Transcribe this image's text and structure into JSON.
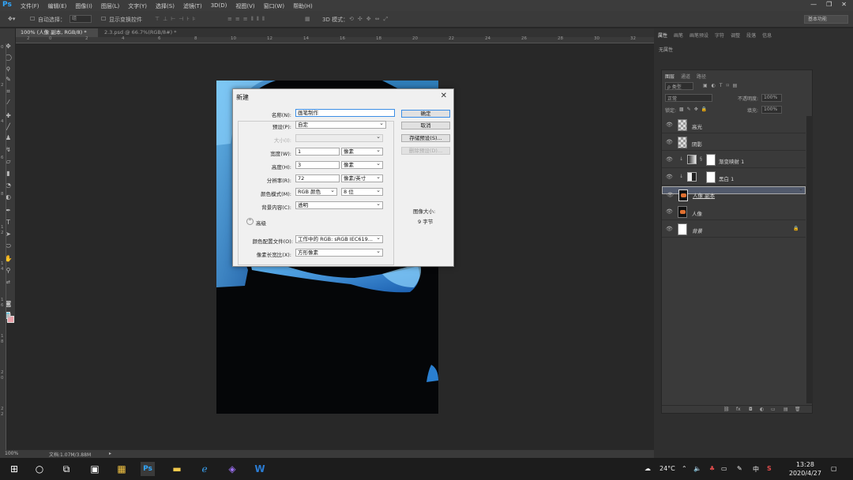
{
  "app": {
    "logo": "Ps",
    "menu": [
      "文件(F)",
      "编辑(E)",
      "图像(I)",
      "图层(L)",
      "文字(Y)",
      "选择(S)",
      "滤镜(T)",
      "3D(D)",
      "视图(V)",
      "窗口(W)",
      "帮助(H)"
    ],
    "window_controls": [
      "—",
      "❐",
      "✕"
    ]
  },
  "options_bar": {
    "auto_select": "自动选择：",
    "auto_select_value": "组",
    "show_transform": "显示变换控件",
    "mode_3d": "3D 模式：",
    "workspace": "基本功能"
  },
  "tabs": [
    {
      "label": "100% (人像 副本, RGB/8) *",
      "active": true
    },
    {
      "label": "2.3.psd @ 66.7%(RGB/8#) *",
      "active": false
    }
  ],
  "ruler_h": [
    "2",
    "0",
    "2",
    "4",
    "6",
    "8",
    "10",
    "12",
    "14",
    "16",
    "18",
    "20",
    "22",
    "24",
    "26",
    "28",
    "30",
    "32"
  ],
  "ruler_v": [
    "0",
    "2",
    "4",
    "6",
    "8",
    "1",
    "2",
    "1",
    "4",
    "1",
    "6",
    "1",
    "8",
    "2",
    "0",
    "2",
    "2"
  ],
  "statusbar": {
    "zoom": "100%",
    "doc": "文档:1.07M/3.88M"
  },
  "right_panel": {
    "tabs": [
      "属性",
      "画笔",
      "画笔预设",
      "字符",
      "调整",
      "段落",
      "信息"
    ],
    "sub": "无属性"
  },
  "layers_panel": {
    "tabs": [
      "图层",
      "通道",
      "路径"
    ],
    "kind": "ρ 类型",
    "blend": "正常",
    "opacity_label": "不透明度:",
    "opacity": "100%",
    "lock_label": "锁定:",
    "fill_label": "填充:",
    "fill": "100%",
    "layers": [
      {
        "name": "高光",
        "type": "transparent"
      },
      {
        "name": "阴影",
        "type": "transparent"
      },
      {
        "name": "渐变映射 1",
        "type": "adjust"
      },
      {
        "name": "黑白 1",
        "type": "adjust"
      },
      {
        "name": "人像 副本",
        "type": "photo",
        "selected": true
      },
      {
        "name": "人像",
        "type": "photo"
      },
      {
        "name": "背景",
        "type": "white",
        "locked": true
      }
    ],
    "bottom_icons": [
      "⛓",
      "fx",
      "◘",
      "◐",
      "▭",
      "▤",
      "🗑"
    ]
  },
  "dialog": {
    "title": "新建",
    "close": "✕",
    "name_label": "名称(N):",
    "name_value": "画笔制作",
    "preset_label": "预设(P):",
    "preset_value": "自定",
    "size_label": "大小(I):",
    "width_label": "宽度(W):",
    "width_value": "1",
    "width_unit": "像素",
    "height_label": "高度(H):",
    "height_value": "3",
    "height_unit": "像素",
    "res_label": "分辨率(R):",
    "res_value": "72",
    "res_unit": "像素/英寸",
    "mode_label": "颜色模式(M):",
    "mode_value": "RGB 颜色",
    "bits_value": "8 位",
    "bg_label": "背景内容(C):",
    "bg_value": "透明",
    "advanced": "高级",
    "profile_label": "颜色配置文件(O):",
    "profile_value": "工作中的 RGB: sRGB IEC619...",
    "aspect_label": "像素长宽比(X):",
    "aspect_value": "方形像素",
    "btn_ok": "确定",
    "btn_cancel": "取消",
    "btn_save": "存储预设(S)...",
    "btn_delete": "删除预设(D)...",
    "img_size_label": "图像大小:",
    "img_size_value": "9 字节"
  },
  "taskbar": {
    "weather": "24°C",
    "ime": "中",
    "time": "13:28",
    "date": "2020/4/27"
  }
}
